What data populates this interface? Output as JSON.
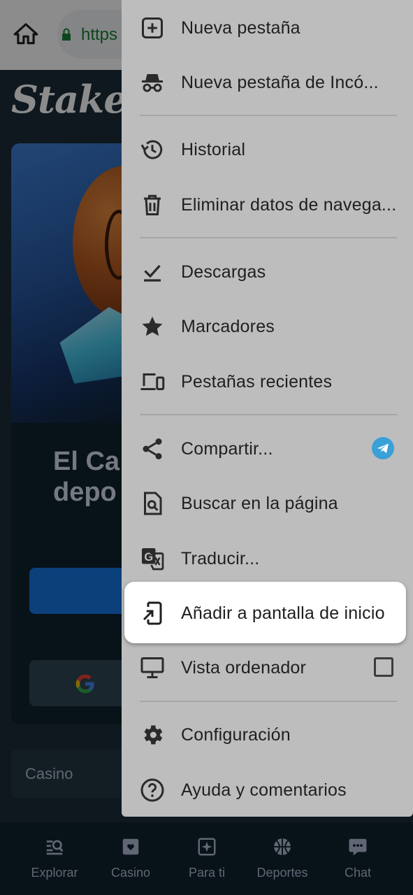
{
  "browser": {
    "url_fragment": "https",
    "home_icon": "home-icon",
    "lock_icon": "lock-icon"
  },
  "site": {
    "logo": "Stake",
    "promo_title_line1": "El Ca",
    "promo_title_line2": "depo",
    "search_label": "Casino"
  },
  "bottom_nav": [
    {
      "label": "Explorar",
      "icon": "explore-icon"
    },
    {
      "label": "Casino",
      "icon": "casino-cards-icon"
    },
    {
      "label": "Para ti",
      "icon": "sparkle-icon"
    },
    {
      "label": "Deportes",
      "icon": "basketball-icon"
    },
    {
      "label": "Chat",
      "icon": "chat-icon"
    }
  ],
  "menu": {
    "items": [
      {
        "label": "Nueva pestaña",
        "icon": "new-tab-icon"
      },
      {
        "label": "Nueva pestaña de Incó...",
        "icon": "incognito-icon"
      },
      {
        "label": "Historial",
        "icon": "history-icon"
      },
      {
        "label": "Eliminar datos de navega...",
        "icon": "trash-icon"
      },
      {
        "label": "Descargas",
        "icon": "download-icon"
      },
      {
        "label": "Marcadores",
        "icon": "star-icon"
      },
      {
        "label": "Pestañas recientes",
        "icon": "devices-icon"
      },
      {
        "label": "Compartir...",
        "icon": "share-icon"
      },
      {
        "label": "Buscar en la página",
        "icon": "find-in-page-icon"
      },
      {
        "label": "Traducir...",
        "icon": "translate-icon"
      },
      {
        "label": "Añadir a pantalla de inicio",
        "icon": "add-to-home-icon"
      },
      {
        "label": "Vista ordenador",
        "icon": "desktop-icon"
      },
      {
        "label": "Configuración",
        "icon": "gear-icon"
      },
      {
        "label": "Ayuda y comentarios",
        "icon": "help-icon"
      }
    ],
    "desktop_view_checked": false,
    "highlighted_item": "Añadir a pantalla de inicio"
  },
  "colors": {
    "menu_bg": "#bdbdbd",
    "highlight_bg": "#ffffff",
    "site_bg": "#1a2c38",
    "accent_blue": "#1475e1",
    "url_green": "#188038"
  }
}
